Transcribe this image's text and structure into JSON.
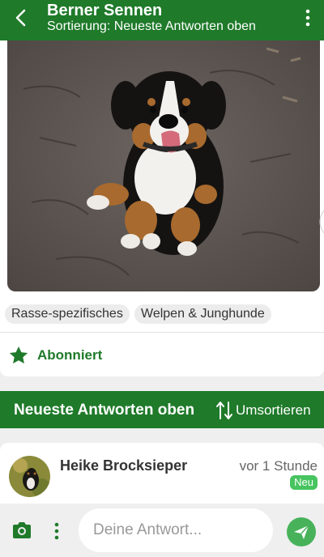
{
  "header": {
    "title": "Berner Sennen",
    "subtitle": "Sortierung: Neueste Antworten oben"
  },
  "post": {
    "tags": [
      "Rasse-spezifisches",
      "Welpen & Junghunde"
    ],
    "subscribe_label": "Abonniert"
  },
  "sortbar": {
    "title": "Neueste Antworten oben",
    "resort_label": "Umsortieren"
  },
  "reply": {
    "author": "Heike Brocksieper",
    "time": "vor 1 Stunde",
    "badge": "Neu"
  },
  "composer": {
    "placeholder": "Deine Antwort..."
  },
  "colors": {
    "brand_green": "#1f7a2a",
    "badge_green": "#47c460",
    "send_green": "#47b25a"
  },
  "icons": [
    "back-icon",
    "more-icon",
    "star-icon",
    "sort-icon",
    "camera-icon",
    "send-icon"
  ]
}
